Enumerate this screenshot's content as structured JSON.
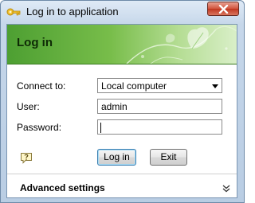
{
  "window": {
    "title": "Log in to application",
    "icons": {
      "app": "key-icon",
      "close": "close-icon"
    }
  },
  "banner": {
    "heading": "Log in",
    "decoration": "leaf-vine-icon"
  },
  "form": {
    "connect_to": {
      "label": "Connect to:",
      "value": "Local computer"
    },
    "user": {
      "label": "User:",
      "value": "admin"
    },
    "password": {
      "label": "Password:",
      "value": ""
    }
  },
  "actions": {
    "login_label": "Log in",
    "exit_label": "Exit",
    "help_icon": "help-icon"
  },
  "advanced": {
    "label": "Advanced settings",
    "expand_icon": "chevron-double-down-icon"
  },
  "colors": {
    "banner_dark": "#4d9f32",
    "banner_light": "#d9efc8",
    "close_red": "#c0361f",
    "frame_blue": "#b9cde3"
  }
}
